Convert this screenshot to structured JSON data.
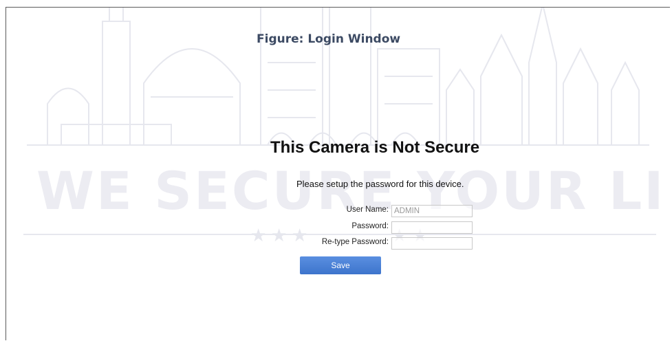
{
  "figure_title": "Figure: Login Window",
  "watermark": {
    "text": "WE SECURE YOUR LIFE"
  },
  "main": {
    "heading": "This Camera is Not Secure",
    "subtext": "Please setup the password for this device."
  },
  "form": {
    "username_label": "User Name:",
    "username_value": "ADMIN",
    "password_label": "Password:",
    "password_value": "",
    "retype_label": "Re-type Password:",
    "retype_value": "",
    "save_label": "Save"
  },
  "colors": {
    "button": "#4a80d6",
    "watermark": "#ececf2",
    "figure_title": "#3c4a63"
  }
}
